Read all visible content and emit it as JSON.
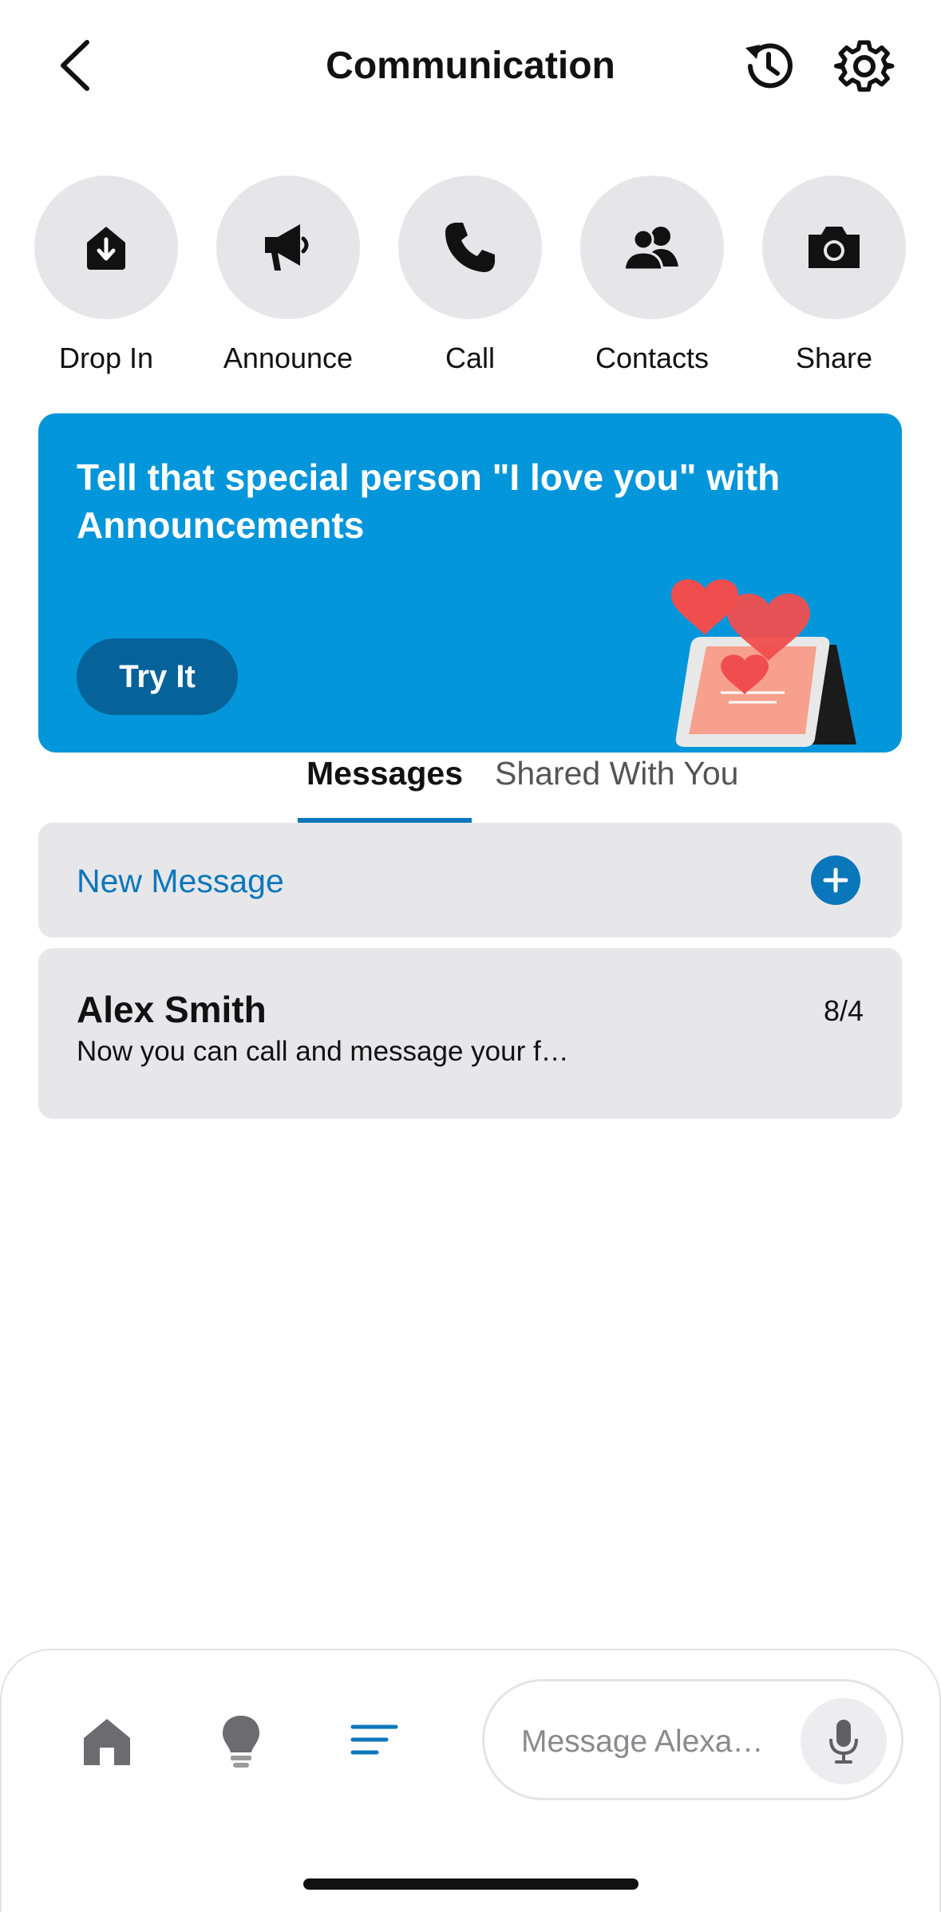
{
  "header": {
    "title": "Communication"
  },
  "actions": [
    {
      "label": "Drop In",
      "icon": "drop-in-icon"
    },
    {
      "label": "Announce",
      "icon": "megaphone-icon"
    },
    {
      "label": "Call",
      "icon": "phone-icon"
    },
    {
      "label": "Contacts",
      "icon": "contacts-icon"
    },
    {
      "label": "Share",
      "icon": "camera-icon"
    }
  ],
  "banner": {
    "title": "Tell that special person \"I love you\" with Announcements",
    "button_label": "Try It",
    "background_color": "#0496db",
    "button_color": "#05639a"
  },
  "tabs": [
    {
      "label": "Messages",
      "selected": true
    },
    {
      "label": "Shared With You",
      "selected": false
    }
  ],
  "new_message": {
    "label": "New Message"
  },
  "conversations": [
    {
      "name": "Alex Smith",
      "date": "8/4",
      "preview": "Now you can call and message your f…"
    }
  ],
  "bottom_nav": {
    "items": [
      {
        "icon": "home-icon"
      },
      {
        "icon": "lightbulb-icon"
      },
      {
        "icon": "menu-lines-icon",
        "active": true
      }
    ],
    "search_placeholder": "Message Alexa…"
  },
  "colors": {
    "accent": "#0a77bb",
    "card_bg": "#e7e7e9"
  }
}
